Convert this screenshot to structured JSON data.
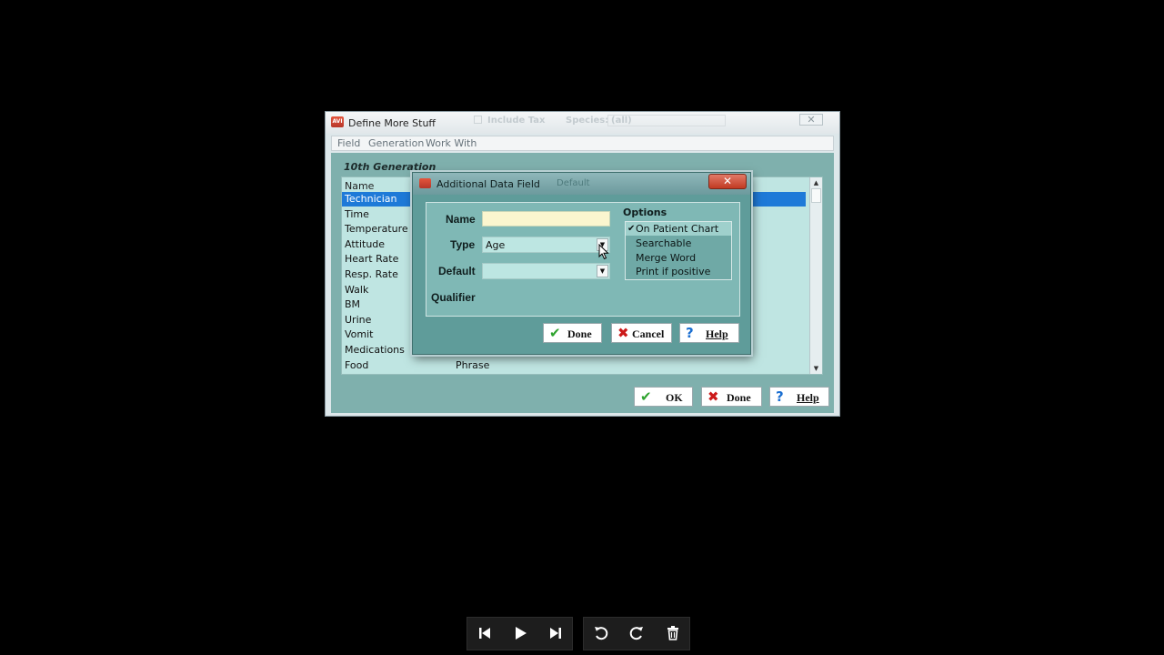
{
  "main_window": {
    "title": "Define More Stuff",
    "ghost_checkbox_label": "Include Tax",
    "ghost_species_label": "Species:",
    "ghost_species_value": "(all)",
    "close_glyph": "✕",
    "menu": [
      "Field",
      "Generation",
      "Work With"
    ],
    "generation_label": "10th Generation",
    "list_header": "Name",
    "rows": [
      {
        "name": "Technician",
        "type": ""
      },
      {
        "name": "Time",
        "type": ""
      },
      {
        "name": "Temperature",
        "type": ""
      },
      {
        "name": "Attitude",
        "type": ""
      },
      {
        "name": "Heart Rate",
        "type": ""
      },
      {
        "name": "Resp. Rate",
        "type": ""
      },
      {
        "name": "Walk",
        "type": ""
      },
      {
        "name": "BM",
        "type": ""
      },
      {
        "name": "Urine",
        "type": ""
      },
      {
        "name": "Vomit",
        "type": ""
      },
      {
        "name": "Medications",
        "type": ""
      },
      {
        "name": "Food",
        "type": "Phrase"
      }
    ],
    "selected_row": "Technician",
    "buttons": {
      "ok": "OK",
      "done": "Done",
      "help": "Help"
    }
  },
  "dialog": {
    "title": "Additional Data Field",
    "ghost_title": "Default",
    "close_glyph": "✕",
    "labels": {
      "name": "Name",
      "type": "Type",
      "default": "Default",
      "qualifier": "Qualifier"
    },
    "name_value": "",
    "type_value": "Age",
    "default_value": "",
    "options_title": "Options",
    "options": [
      {
        "label": "On Patient Chart",
        "checked": true
      },
      {
        "label": "Searchable",
        "checked": false
      },
      {
        "label": "Merge Word",
        "checked": false
      },
      {
        "label": "Print if positive",
        "checked": false
      }
    ],
    "check_glyph": "✔",
    "buttons": {
      "done": "Done",
      "cancel": "Cancel",
      "help": "Help"
    }
  },
  "player": {
    "controls": [
      "previous-icon",
      "play-icon",
      "next-icon",
      "undo-icon",
      "redo-icon",
      "trash-icon"
    ]
  },
  "colors": {
    "accent_selection": "#1e7ad8",
    "dialog_close": "#c13a22",
    "ok_check": "#2ea32e",
    "cancel_x": "#cc1a1a",
    "help_q": "#1b6fd1"
  }
}
